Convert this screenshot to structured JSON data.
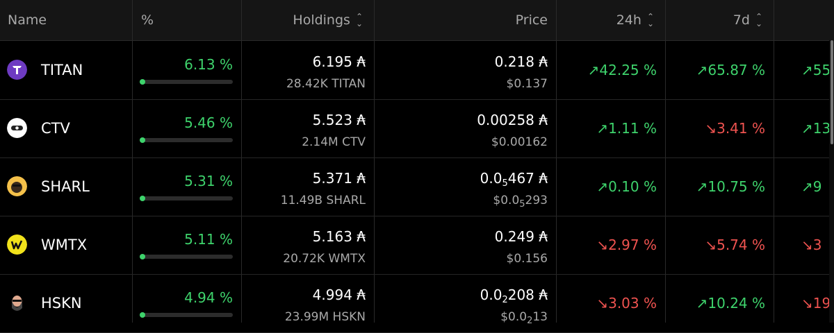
{
  "header": {
    "name": "Name",
    "percent": "%",
    "holdings": "Holdings",
    "price": "Price",
    "change_24h": "24h",
    "change_7d": "7d",
    "sort_icon": "⌃⌄"
  },
  "rows": [
    {
      "symbol": "TITAN",
      "icon": "titan-logo",
      "pct": "6.13 %",
      "pct_fraction": 0.0613,
      "holdings": "6.195 ₳",
      "holdings_sub": "28.42K TITAN",
      "price": "0.218 ₳",
      "price_usd": "$0.137",
      "c24": "↗42.25 %",
      "c24_dir": "up",
      "c7": "↗65.87 %",
      "c7_dir": "up",
      "cnext": "↗55",
      "cnext_dir": "up"
    },
    {
      "symbol": "CTV",
      "icon": "ctv-logo",
      "pct": "5.46 %",
      "pct_fraction": 0.0546,
      "holdings": "5.523 ₳",
      "holdings_sub": "2.14M CTV",
      "price": "0.00258 ₳",
      "price_usd": "$0.00162",
      "c24": "↗1.11 %",
      "c24_dir": "up",
      "c7": "↘3.41 %",
      "c7_dir": "down",
      "cnext": "↗13",
      "cnext_dir": "up"
    },
    {
      "symbol": "SHARL",
      "icon": "sharl-logo",
      "pct": "5.31 %",
      "pct_fraction": 0.0531,
      "holdings": "5.371 ₳",
      "holdings_sub": "11.49B SHARL",
      "price_pre": "0.0",
      "price_subscript": "5",
      "price_post": "467 ₳",
      "price_usd_pre": "$0.0",
      "price_usd_subscript": "5",
      "price_usd_post": "293",
      "c24": "↗0.10 %",
      "c24_dir": "up",
      "c7": "↗10.75 %",
      "c7_dir": "up",
      "cnext": "↗9",
      "cnext_dir": "up"
    },
    {
      "symbol": "WMTX",
      "icon": "wmtx-logo",
      "pct": "5.11 %",
      "pct_fraction": 0.0511,
      "holdings": "5.163 ₳",
      "holdings_sub": "20.72K WMTX",
      "price": "0.249 ₳",
      "price_usd": "$0.156",
      "c24": "↘2.97 %",
      "c24_dir": "down",
      "c7": "↘5.74 %",
      "c7_dir": "down",
      "cnext": "↘3",
      "cnext_dir": "down"
    },
    {
      "symbol": "HSKN",
      "icon": "hskn-logo",
      "pct": "4.94 %",
      "pct_fraction": 0.0494,
      "holdings": "4.994 ₳",
      "holdings_sub": "23.99M HSKN",
      "price_pre": "0.0",
      "price_subscript": "2",
      "price_post": "208 ₳",
      "price_usd_pre": "$0.0",
      "price_usd_subscript": "2",
      "price_usd_post": "13",
      "c24": "↘3.03 %",
      "c24_dir": "down",
      "c7": "↗10.24 %",
      "c7_dir": "up",
      "cnext": "↘19",
      "cnext_dir": "down"
    }
  ],
  "colors": {
    "up": "#3ed36c",
    "down": "#ef5350",
    "header_bg": "#151515",
    "bg": "#000000"
  }
}
